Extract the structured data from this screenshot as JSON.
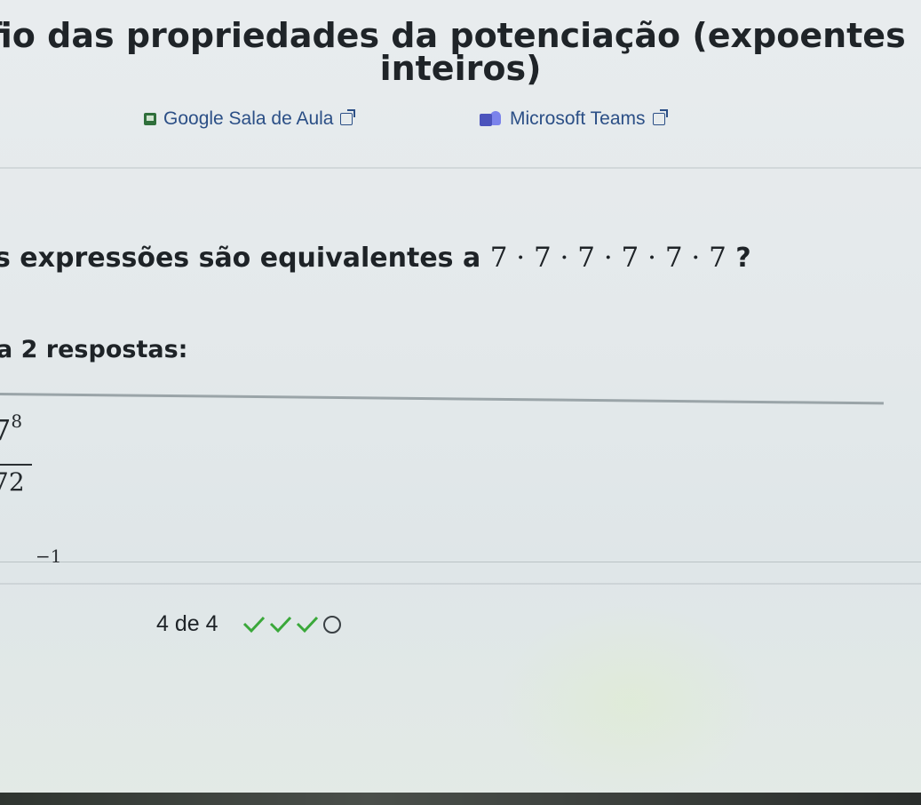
{
  "header": {
    "title_line_1": "afio das propriedades da potenciação (expoentes",
    "title_line_2": "inteiros)"
  },
  "share": {
    "google_label": "Google Sala de Aula",
    "teams_label": "Microsoft Teams"
  },
  "question": {
    "prompt": "s expressões são equivalentes a",
    "expression": "7 · 7 · 7 · 7 · 7 · 7",
    "suffix": "?"
  },
  "instruction": "a 2 respostas:",
  "choices": [
    {
      "numerator": "7",
      "numerator_exp": "8",
      "denominator": "72"
    },
    {
      "text": "−1"
    }
  ],
  "progress": {
    "label": "4 de 4",
    "completed": 3,
    "total": 4,
    "check_color": "#3aa83a"
  }
}
